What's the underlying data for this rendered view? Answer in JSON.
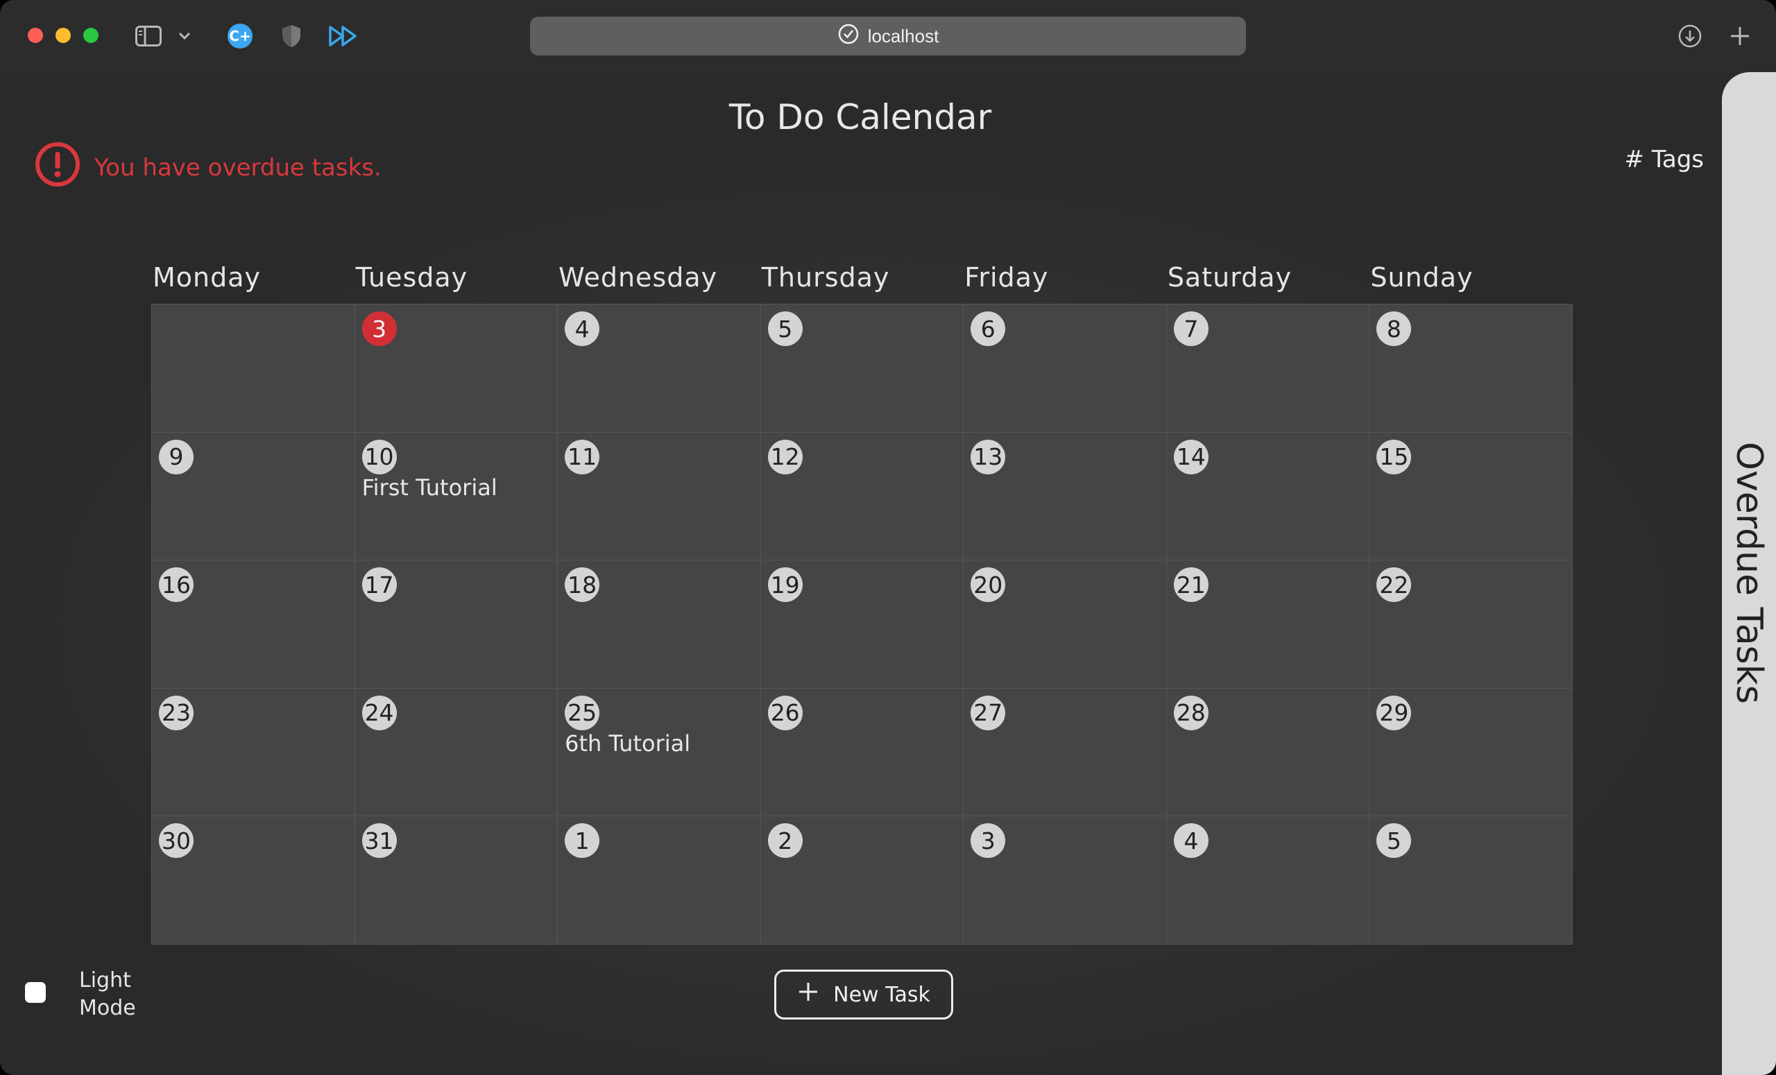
{
  "browser": {
    "address": "localhost"
  },
  "page": {
    "title": "To Do Calendar",
    "alert": "You have overdue tasks.",
    "tags_link": "# Tags"
  },
  "calendar": {
    "weekdays": [
      "Monday",
      "Tuesday",
      "Wednesday",
      "Thursday",
      "Friday",
      "Saturday",
      "Sunday"
    ],
    "weeks": [
      [
        {
          "n": ""
        },
        {
          "n": "3",
          "today": true
        },
        {
          "n": "4"
        },
        {
          "n": "5"
        },
        {
          "n": "6"
        },
        {
          "n": "7"
        },
        {
          "n": "8"
        }
      ],
      [
        {
          "n": "9"
        },
        {
          "n": "10",
          "task": "First Tutorial"
        },
        {
          "n": "11"
        },
        {
          "n": "12"
        },
        {
          "n": "13"
        },
        {
          "n": "14"
        },
        {
          "n": "15"
        }
      ],
      [
        {
          "n": "16"
        },
        {
          "n": "17"
        },
        {
          "n": "18"
        },
        {
          "n": "19"
        },
        {
          "n": "20"
        },
        {
          "n": "21"
        },
        {
          "n": "22"
        }
      ],
      [
        {
          "n": "23"
        },
        {
          "n": "24"
        },
        {
          "n": "25",
          "task": "6th Tutorial"
        },
        {
          "n": "26"
        },
        {
          "n": "27"
        },
        {
          "n": "28"
        },
        {
          "n": "29"
        }
      ],
      [
        {
          "n": "30"
        },
        {
          "n": "31"
        },
        {
          "n": "1"
        },
        {
          "n": "2"
        },
        {
          "n": "3"
        },
        {
          "n": "4"
        },
        {
          "n": "5"
        }
      ]
    ]
  },
  "footer": {
    "light_mode_line1": "Light",
    "light_mode_line2": "Mode",
    "new_task_label": "New Task"
  },
  "side_panel": {
    "label": "Overdue Tasks"
  },
  "colors": {
    "alert": "#d9383c",
    "today": "#d12f35",
    "accent_icon": "#3aa7f0"
  }
}
